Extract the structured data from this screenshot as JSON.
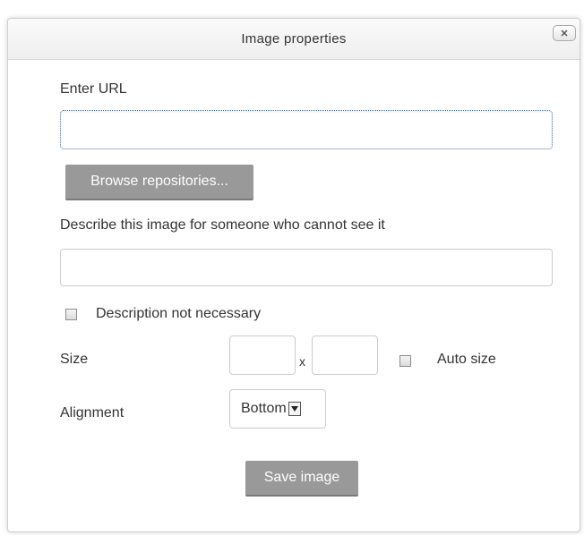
{
  "dialog": {
    "title": "Image properties",
    "close_label": "X"
  },
  "url": {
    "label": "Enter URL",
    "value": "",
    "placeholder": ""
  },
  "browse_button": {
    "label": "Browse repositories..."
  },
  "description": {
    "label": "Describe this image for someone who cannot see it",
    "value": "",
    "placeholder": ""
  },
  "description_not_necessary": {
    "label": "Description not necessary",
    "checked": false
  },
  "size": {
    "label": "Size",
    "separator": "x",
    "width_value": "",
    "height_value": "",
    "auto_size_label": "Auto size",
    "auto_size_checked": false
  },
  "alignment": {
    "label": "Alignment",
    "selected": "Bottom"
  },
  "save_button": {
    "label": "Save image"
  },
  "icons": {
    "close": "close-icon",
    "dropdown": "chevron-down-icon"
  }
}
